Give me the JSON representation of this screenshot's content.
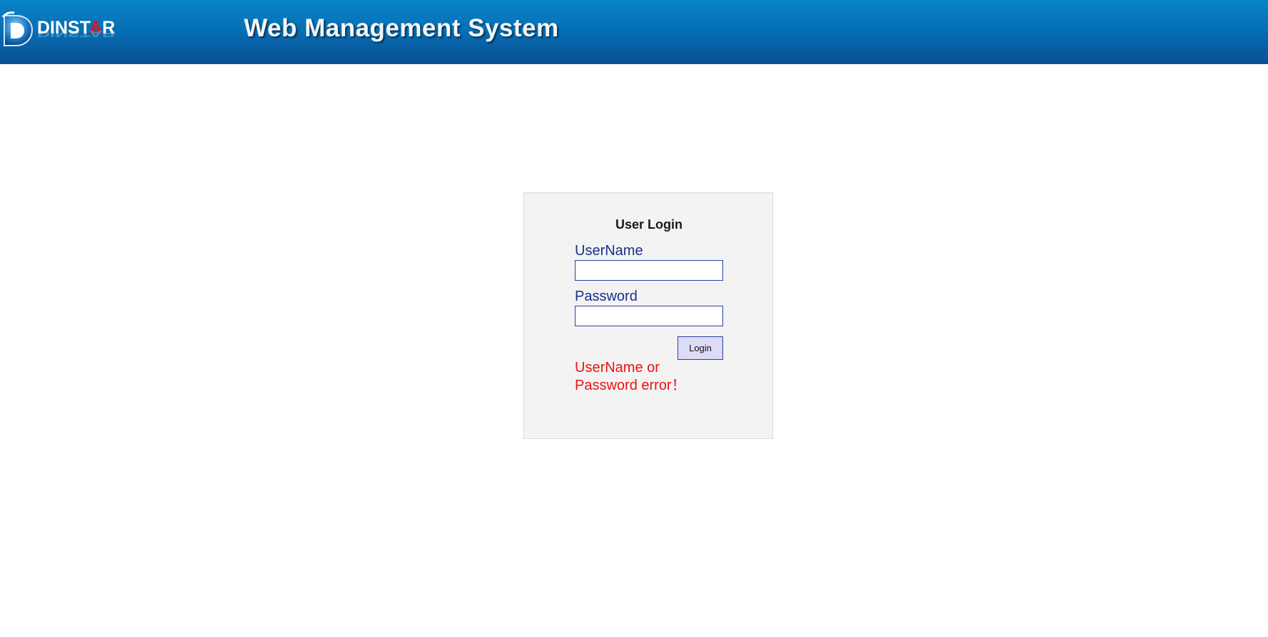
{
  "header": {
    "logo": {
      "brand_prefix": "DINST",
      "brand_accent": "A",
      "brand_suffix": "R",
      "brand_full": "DINSTAR"
    },
    "title": "Web Management System"
  },
  "login": {
    "title": "User Login",
    "username_label": "UserName",
    "username_value": "",
    "password_label": "Password",
    "password_value": "",
    "button_label": "Login",
    "error_message": "UserName or Password error！"
  },
  "colors": {
    "header_top": "#0a84c9",
    "header_bottom": "#0a4f93",
    "panel_bg": "#f3f3f3",
    "label_color": "#17318a",
    "error_color": "#ee1111",
    "button_bg": "#dcdcf6",
    "brand_accent": "#e0141c"
  },
  "icons": {
    "logo_mark": "dinstar-d-logo-icon"
  }
}
